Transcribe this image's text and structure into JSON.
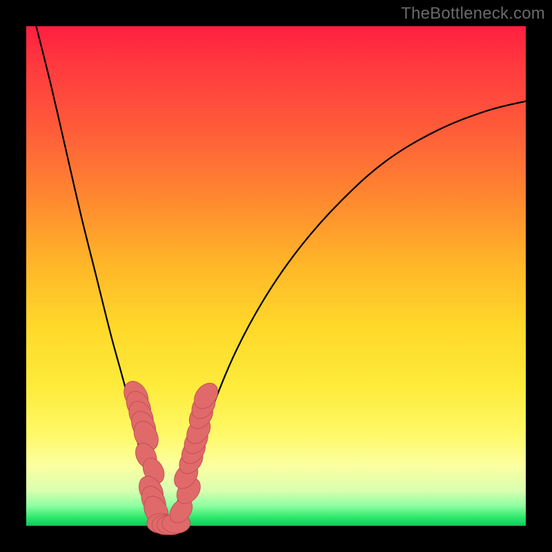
{
  "watermark": "TheBottleneck.com",
  "colors": {
    "frame": "#000000",
    "gradient_top": "#ff1f40",
    "gradient_bottom": "#13c75a",
    "curve": "#000000",
    "marker_fill": "#e06a6a",
    "marker_stroke": "#c34f55"
  },
  "chart_data": {
    "type": "line",
    "title": "",
    "xlabel": "",
    "ylabel": "",
    "xlim": [
      0,
      100
    ],
    "ylim": [
      0,
      100
    ],
    "note": "Two smooth curves (approximate V-shape) over a red-to-green vertical gradient. Axis values are normalized 0–100; y decreases downward visually (0 at top, 100 at bottom). Markers are rounded pink blobs clustered near the bottom of the V.",
    "series": [
      {
        "name": "left-branch",
        "x": [
          2,
          5,
          8,
          11,
          14,
          17,
          20,
          22,
          24,
          26,
          27,
          28
        ],
        "y": [
          0,
          12,
          25,
          38,
          50,
          62,
          73,
          82,
          89,
          95,
          98,
          100
        ]
      },
      {
        "name": "right-branch",
        "x": [
          28,
          30,
          33,
          37,
          42,
          48,
          55,
          63,
          72,
          82,
          92,
          100
        ],
        "y": [
          100,
          96,
          88,
          77,
          65,
          54,
          44,
          35,
          27,
          21,
          17,
          15
        ]
      }
    ],
    "markers": [
      {
        "x": 22.0,
        "y": 74,
        "r": 2.3
      },
      {
        "x": 22.5,
        "y": 76,
        "r": 2.3
      },
      {
        "x": 23.0,
        "y": 78,
        "r": 2.3
      },
      {
        "x": 23.5,
        "y": 80,
        "r": 2.3
      },
      {
        "x": 24.0,
        "y": 82,
        "r": 2.3
      },
      {
        "x": 24.0,
        "y": 86,
        "r": 2.0
      },
      {
        "x": 25.5,
        "y": 89,
        "r": 2.0
      },
      {
        "x": 25.0,
        "y": 93,
        "r": 2.3
      },
      {
        "x": 25.5,
        "y": 95,
        "r": 2.3
      },
      {
        "x": 26.0,
        "y": 97,
        "r": 2.3
      },
      {
        "x": 27.0,
        "y": 99.5,
        "r": 2.1
      },
      {
        "x": 28.0,
        "y": 99.8,
        "r": 2.1
      },
      {
        "x": 29.0,
        "y": 99.8,
        "r": 2.1
      },
      {
        "x": 30.0,
        "y": 99.5,
        "r": 2.1
      },
      {
        "x": 31.0,
        "y": 97,
        "r": 2.0
      },
      {
        "x": 32.5,
        "y": 93,
        "r": 2.1
      },
      {
        "x": 32.0,
        "y": 90,
        "r": 2.1
      },
      {
        "x": 33.0,
        "y": 87,
        "r": 2.1
      },
      {
        "x": 33.5,
        "y": 85,
        "r": 2.1
      },
      {
        "x": 34.0,
        "y": 83,
        "r": 2.1
      },
      {
        "x": 34.5,
        "y": 81,
        "r": 2.1
      },
      {
        "x": 35.0,
        "y": 78,
        "r": 2.1
      },
      {
        "x": 35.5,
        "y": 76,
        "r": 2.1
      },
      {
        "x": 36.0,
        "y": 74,
        "r": 2.1
      }
    ]
  }
}
